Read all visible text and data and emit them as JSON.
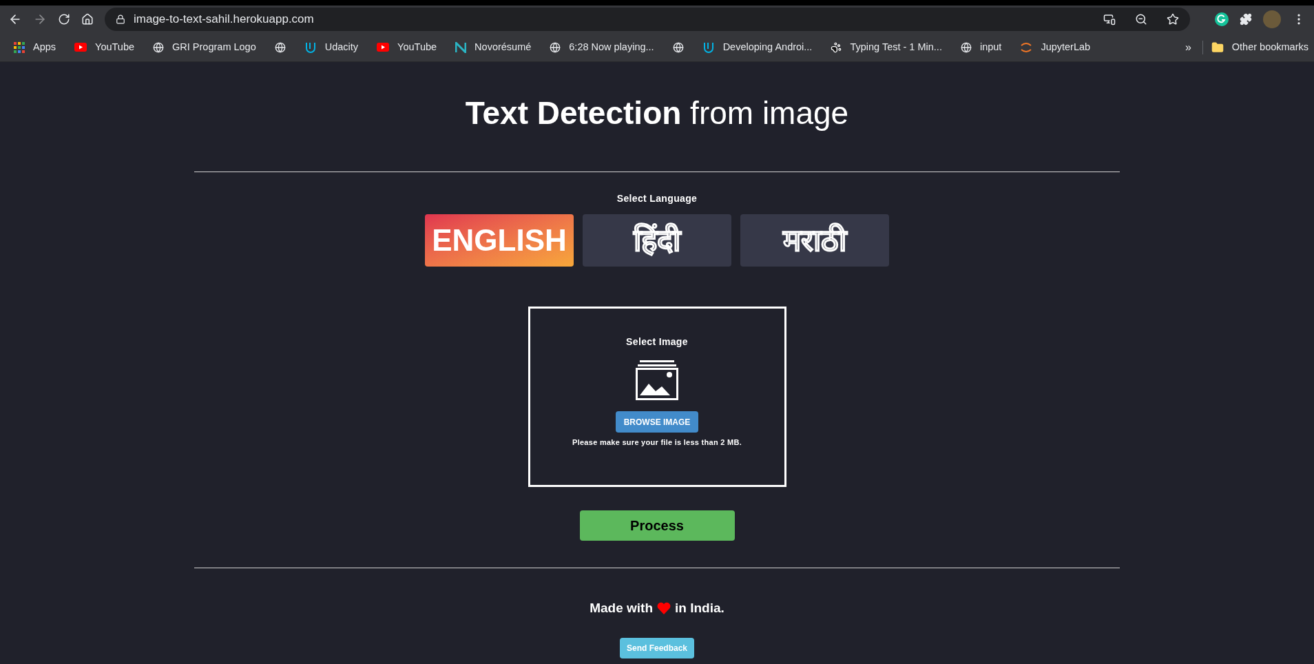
{
  "browser": {
    "url": "image-to-text-sahil.herokuapp.com",
    "bookmarks": [
      {
        "kind": "apps",
        "label": "Apps"
      },
      {
        "kind": "video",
        "label": "YouTube"
      },
      {
        "kind": "globe",
        "label": "GRI Program Logo"
      },
      {
        "kind": "globe"
      },
      {
        "kind": "u",
        "label": "Udacity"
      },
      {
        "kind": "video",
        "label": "YouTube"
      },
      {
        "kind": "n",
        "label": "Novorésumé"
      },
      {
        "kind": "globe",
        "label": "6:28 Now playing..."
      },
      {
        "kind": "globe"
      },
      {
        "kind": "u",
        "label": "Developing Androi..."
      },
      {
        "kind": "paw",
        "label": "Typing Test - 1 Min..."
      },
      {
        "kind": "globe",
        "label": "input"
      },
      {
        "kind": "jupyter",
        "label": "JupyterLab"
      }
    ],
    "overflow": "»",
    "other_bookmarks": "Other bookmarks"
  },
  "page": {
    "title": "**Text Detection** from image",
    "language_label": "Select Language",
    "languages": [
      {
        "label": "ENGLISH",
        "selected": true
      },
      {
        "label": "हिंदी",
        "selected": false
      },
      {
        "label": "मराठी",
        "selected": false
      }
    ],
    "upload": {
      "title": "Select Image",
      "button": "BROWSE IMAGE",
      "note": "Please make sure your file is less than 2 MB."
    },
    "process": "Process",
    "footer": {
      "before": "Made with",
      "after": "in India.",
      "feedback": "Send Feedback"
    }
  }
}
